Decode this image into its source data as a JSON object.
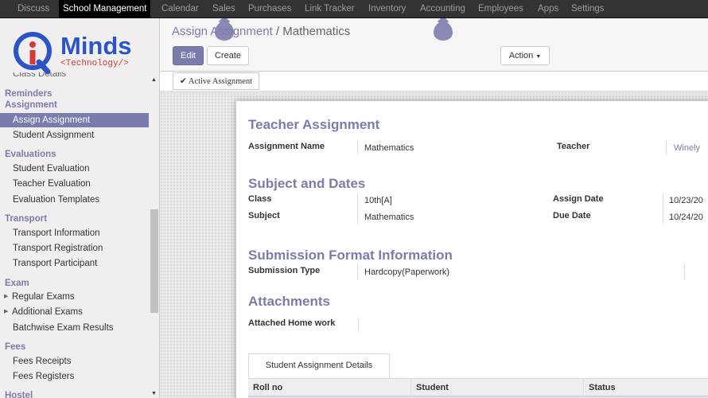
{
  "topbar": {
    "menus": [
      "Discuss",
      "School Management",
      "Calendar",
      "Sales",
      "Purchases",
      "Link Tracker",
      "Inventory",
      "Accounting",
      "Employees",
      "Apps",
      "Settings"
    ]
  },
  "logo": {
    "name": "Minds",
    "tagline": "<Technology/>",
    "primary_color": "#2b55c6",
    "accent_color": "#d23b3b"
  },
  "sidebar": {
    "cut_label": "Class Details",
    "groups": [
      {
        "title": "Reminders Assignment"
      },
      {
        "title": "Evaluations"
      },
      {
        "title": "Transport"
      },
      {
        "title": "Exam"
      },
      {
        "title": "Fees"
      },
      {
        "title": "Hostel"
      }
    ],
    "items": {
      "assign_assignment": "Assign Assignment",
      "student_assignment": "Student Assignment",
      "student_evaluation": "Student Evaluation",
      "teacher_evaluation": "Teacher Evaluation",
      "evaluation_templates": "Evaluation Templates",
      "transport_information": "Transport Information",
      "transport_registration": "Transport Registration",
      "transport_participant": "Transport Participant",
      "regular_exams": "Regular Exams",
      "additional_exams": "Additional Exams",
      "batchwise_exam_results": "Batchwise Exam Results",
      "fees_receipts": "Fees Receipts",
      "fees_registers": "Fees Registers"
    }
  },
  "breadcrumb": {
    "parent": "Assign Assignment",
    "separator": "/",
    "current": "Mathematics"
  },
  "buttons": {
    "edit": "Edit",
    "create": "Create",
    "action": "Action"
  },
  "statusbar": {
    "active_label": "Active Assignment"
  },
  "form": {
    "section_teacher": "Teacher Assignment",
    "assignment_name_label": "Assignment Name",
    "assignment_name": "Mathematics",
    "teacher_label": "Teacher",
    "teacher": "Winely",
    "section_subject": "Subject and Dates",
    "class_label": "Class",
    "class": "10th[A]",
    "subject_label": "Subject",
    "subject": "Mathematics",
    "assign_date_label": "Assign Date",
    "assign_date": "10/23/20",
    "due_date_label": "Due Date",
    "due_date": "10/24/20",
    "section_submission": "Submission Format Information",
    "submission_type_label": "Submission Type",
    "submission_type": "Hardcopy(Paperwork)",
    "section_attachments": "Attachments",
    "attached_homework_label": "Attached Home work",
    "tab_label": "Student Assignment Details",
    "columns": [
      "Roll no",
      "Student",
      "Status"
    ]
  },
  "colors": {
    "primary": "#7c7bad",
    "topbar": "#333333"
  }
}
